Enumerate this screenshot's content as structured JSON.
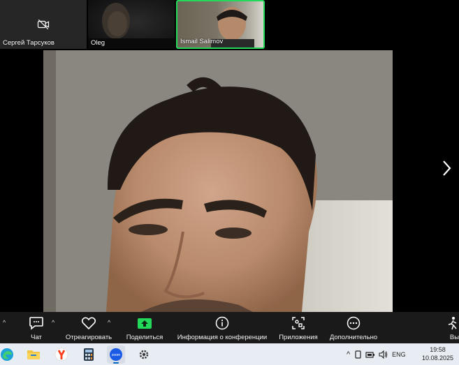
{
  "participants": [
    {
      "name": "Сергей Тарсуков",
      "camera": "off"
    },
    {
      "name": "Oleg",
      "camera": "on"
    },
    {
      "name": "Ismail Salimov",
      "camera": "on",
      "speaking": true
    }
  ],
  "toolbar": {
    "chat": "Чат",
    "react": "Отреагировать",
    "share": "Поделиться",
    "info": "Информация о конференции",
    "apps": "Приложения",
    "more": "Дополнительно",
    "leave_partial": "Вы"
  },
  "colors": {
    "active_speaker": "#23d959",
    "share": "#23d959",
    "taskbar": "#e8edf3"
  },
  "taskbar": {
    "apps": [
      "edge-icon",
      "file-explorer-icon",
      "yandex-browser-icon",
      "calculator-icon",
      "zoom-icon",
      "settings-icon"
    ],
    "zoom_label": "zoom",
    "language": "ENG",
    "time": "19:58",
    "date": "10.08.2025"
  }
}
